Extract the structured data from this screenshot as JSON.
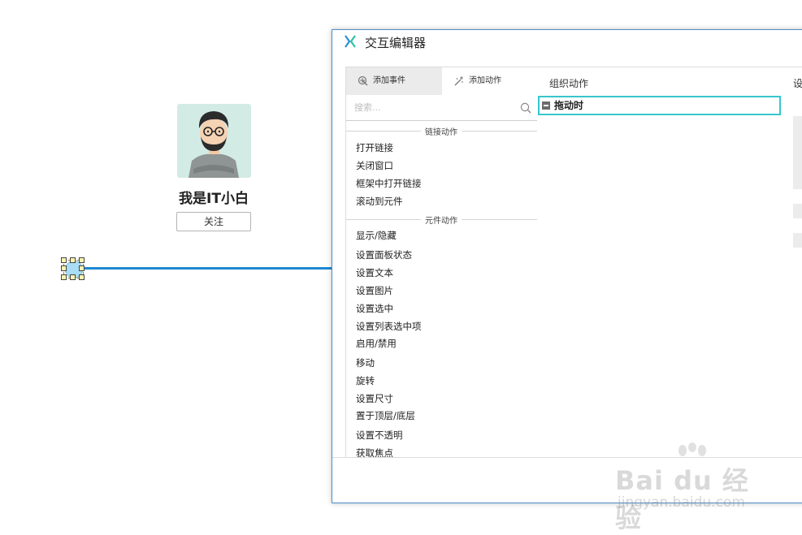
{
  "canvas": {
    "username": "我是IT小白",
    "follow_label": "关注"
  },
  "dialog": {
    "title": "交互编辑器",
    "tabs": [
      {
        "label": "添加事件",
        "icon": "add-event-icon"
      },
      {
        "label": "添加动作",
        "icon": "add-action-icon"
      }
    ],
    "search": {
      "placeholder": "搜索..."
    },
    "sections": [
      {
        "label": "链接动作",
        "items": [
          "打开链接",
          "关闭窗口",
          "框架中打开链接",
          "滚动到元件"
        ]
      },
      {
        "label": "元件动作",
        "items": [
          "显示/隐藏",
          "设置面板状态",
          "设置文本",
          "设置图片",
          "设置选中",
          "设置列表选中项",
          "启用/禁用",
          "移动",
          "旋转",
          "设置尺寸",
          "置于顶层/底层",
          "设置不透明",
          "获取焦点"
        ]
      }
    ],
    "organize": {
      "header": "组织动作",
      "case_label": "拖动时"
    },
    "settings": {
      "header": "设"
    }
  },
  "watermark": {
    "brand": "Bai du 经验",
    "url": "jingyan.baidu.com"
  },
  "colors": {
    "accent_line": "#1e88d0",
    "case_border": "#36c6cf",
    "dialog_border": "#4f8ec9"
  }
}
